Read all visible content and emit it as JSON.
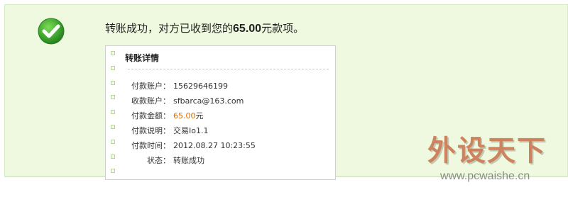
{
  "message": {
    "prefix": "转账成功，对方已收到您的",
    "amount": "65.00",
    "suffix": "元款项。"
  },
  "details": {
    "title": "转账详情",
    "rows": [
      {
        "label": "付款账户：",
        "value": "15629646199"
      },
      {
        "label": "收款账户：",
        "value": "sfbarca@163.com"
      },
      {
        "label": "付款金额：",
        "value": "65.00",
        "unit": "元"
      },
      {
        "label": "付款说明：",
        "value": "交易Io1.1"
      },
      {
        "label": "付款时间：",
        "value": "2012.08.27 10:23:55"
      },
      {
        "label": "状态：",
        "value": "转账成功"
      }
    ]
  },
  "watermark": {
    "logo_text": "外设天下",
    "url": "www.pcwaishe.cn"
  },
  "icons": {
    "success": "check-circle-icon"
  },
  "colors": {
    "panel_bg": "#eef9df",
    "success_green": "#3aa12b",
    "amount_orange": "#e26b00"
  }
}
